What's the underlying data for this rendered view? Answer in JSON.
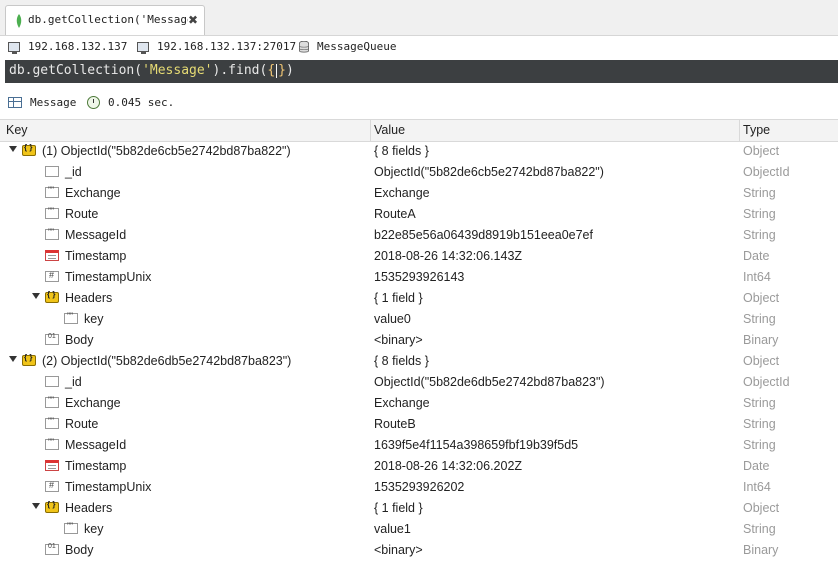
{
  "tab": {
    "title": "db.getCollection('Message…"
  },
  "connection": {
    "host": "192.168.132.137",
    "server": "192.168.132.137:27017",
    "database": "MessageQueue"
  },
  "query": {
    "prefix": "db.getCollection(",
    "collection": "'Message'",
    "middle": ").find(",
    "open_brace": "{",
    "close_brace": "}",
    "suffix": ")"
  },
  "results": {
    "collection": "Message",
    "time": "0.045 sec."
  },
  "columns": {
    "key": "Key",
    "value": "Value",
    "type": "Type"
  },
  "rows": [
    {
      "level": 0,
      "expand": true,
      "icon": "document-icon",
      "key": "(1) ObjectId(\"5b82de6cb5e2742bd87ba822\")",
      "value": "{ 8 fields }",
      "type": "Object"
    },
    {
      "level": 1,
      "expand": false,
      "icon": "objectid-icon",
      "key": "_id",
      "value": "ObjectId(\"5b82de6cb5e2742bd87ba822\")",
      "type": "ObjectId"
    },
    {
      "level": 1,
      "expand": false,
      "icon": "string-icon",
      "key": "Exchange",
      "value": "Exchange",
      "type": "String"
    },
    {
      "level": 1,
      "expand": false,
      "icon": "string-icon",
      "key": "Route",
      "value": "RouteA",
      "type": "String"
    },
    {
      "level": 1,
      "expand": false,
      "icon": "string-icon",
      "key": "MessageId",
      "value": "b22e85e56a06439d8919b151eea0e7ef",
      "type": "String"
    },
    {
      "level": 1,
      "expand": false,
      "icon": "date-icon",
      "key": "Timestamp",
      "value": "2018-08-26 14:32:06.143Z",
      "type": "Date"
    },
    {
      "level": 1,
      "expand": false,
      "icon": "int64-icon",
      "key": "TimestampUnix",
      "value": "1535293926143",
      "type": "Int64"
    },
    {
      "level": 1,
      "expand": true,
      "icon": "object-icon",
      "key": "Headers",
      "value": "{ 1 field }",
      "type": "Object"
    },
    {
      "level": 2,
      "expand": false,
      "icon": "string-icon",
      "key": "key",
      "value": "value0",
      "type": "String"
    },
    {
      "level": 1,
      "expand": false,
      "icon": "binary-icon",
      "key": "Body",
      "value": "<binary>",
      "type": "Binary"
    },
    {
      "level": 0,
      "expand": true,
      "icon": "document-icon",
      "key": "(2) ObjectId(\"5b82de6db5e2742bd87ba823\")",
      "value": "{ 8 fields }",
      "type": "Object"
    },
    {
      "level": 1,
      "expand": false,
      "icon": "objectid-icon",
      "key": "_id",
      "value": "ObjectId(\"5b82de6db5e2742bd87ba823\")",
      "type": "ObjectId"
    },
    {
      "level": 1,
      "expand": false,
      "icon": "string-icon",
      "key": "Exchange",
      "value": "Exchange",
      "type": "String"
    },
    {
      "level": 1,
      "expand": false,
      "icon": "string-icon",
      "key": "Route",
      "value": "RouteB",
      "type": "String"
    },
    {
      "level": 1,
      "expand": false,
      "icon": "string-icon",
      "key": "MessageId",
      "value": "1639f5e4f1154a398659fbf19b39f5d5",
      "type": "String"
    },
    {
      "level": 1,
      "expand": false,
      "icon": "date-icon",
      "key": "Timestamp",
      "value": "2018-08-26 14:32:06.202Z",
      "type": "Date"
    },
    {
      "level": 1,
      "expand": false,
      "icon": "int64-icon",
      "key": "TimestampUnix",
      "value": "1535293926202",
      "type": "Int64"
    },
    {
      "level": 1,
      "expand": true,
      "icon": "object-icon",
      "key": "Headers",
      "value": "{ 1 field }",
      "type": "Object"
    },
    {
      "level": 2,
      "expand": false,
      "icon": "string-icon",
      "key": "key",
      "value": "value1",
      "type": "String"
    },
    {
      "level": 1,
      "expand": false,
      "icon": "binary-icon",
      "key": "Body",
      "value": "<binary>",
      "type": "Binary"
    }
  ]
}
